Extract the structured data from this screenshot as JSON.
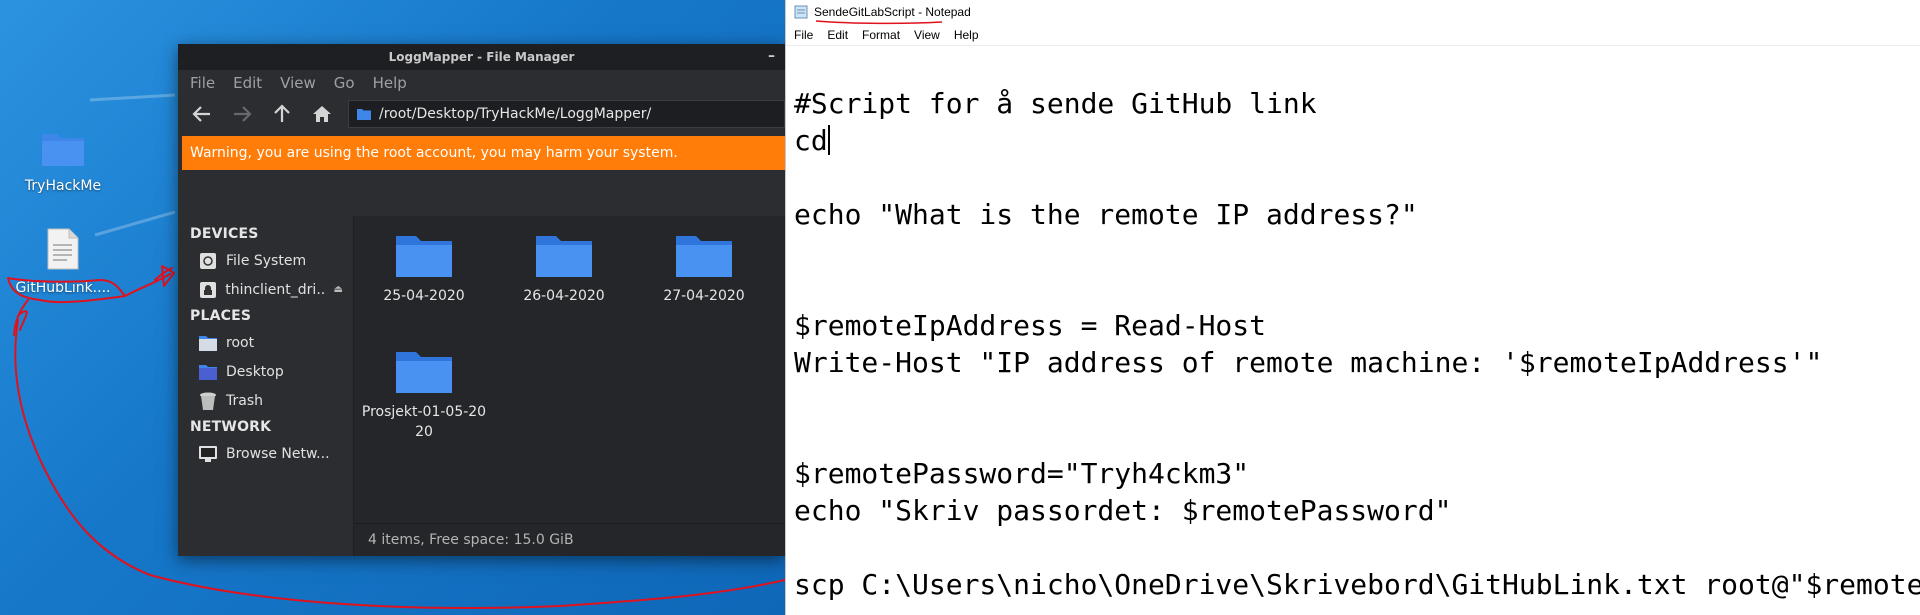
{
  "desktop": {
    "icons": [
      {
        "label": "TryHackMe",
        "icon": "folder-icon"
      },
      {
        "label": "GitHubLink....",
        "icon": "text-file-icon"
      }
    ],
    "annotation_color": "#e0121e"
  },
  "file_manager": {
    "title": "LoggMapper - File Manager",
    "menu": [
      "File",
      "Edit",
      "View",
      "Go",
      "Help"
    ],
    "path": "/root/Desktop/TryHackMe/LoggMapper/",
    "warning": "Warning, you are using the root account, you may harm your system.",
    "sidebar": {
      "devices_header": "DEVICES",
      "devices": [
        {
          "label": "File System",
          "icon": "hard-drive-icon"
        },
        {
          "label": "thinclient_dri...",
          "icon": "network-drive-icon",
          "eject": "⏏"
        }
      ],
      "places_header": "PLACES",
      "places": [
        {
          "label": "root",
          "icon": "home-folder-icon"
        },
        {
          "label": "Desktop",
          "icon": "desktop-folder-icon"
        },
        {
          "label": "Trash",
          "icon": "trash-icon"
        }
      ],
      "network_header": "NETWORK",
      "network": [
        {
          "label": "Browse Netw...",
          "icon": "monitor-icon"
        }
      ]
    },
    "folders": [
      {
        "name": "25-04-2020"
      },
      {
        "name": "26-04-2020"
      },
      {
        "name": "27-04-2020"
      },
      {
        "name": "Prosjekt-01-05-20\n20"
      }
    ],
    "status": "4 items, Free space: 15.0 GiB",
    "colors": {
      "warning_bg": "#ff7d08",
      "folder": "#3f86ea"
    }
  },
  "notepad": {
    "title": "SendeGitLabScript - Notepad",
    "menu": [
      "File",
      "Edit",
      "Format",
      "View",
      "Help"
    ],
    "lines": [
      "#Script for å sende GitHub link",
      "cd",
      "",
      "echo \"What is the remote IP address?\"",
      "",
      "",
      "$remoteIpAddress = Read-Host",
      "Write-Host \"IP address of remote machine: '$remoteIpAddress'\"",
      "",
      "",
      "$remotePassword=\"Tryh4ckm3\"",
      "echo \"Skriv passordet: $remotePassword\"",
      "",
      "scp C:\\Users\\nicho\\OneDrive\\Skrivebord\\GitHubLink.txt root@\"$remoteIpAddress\""
    ]
  }
}
